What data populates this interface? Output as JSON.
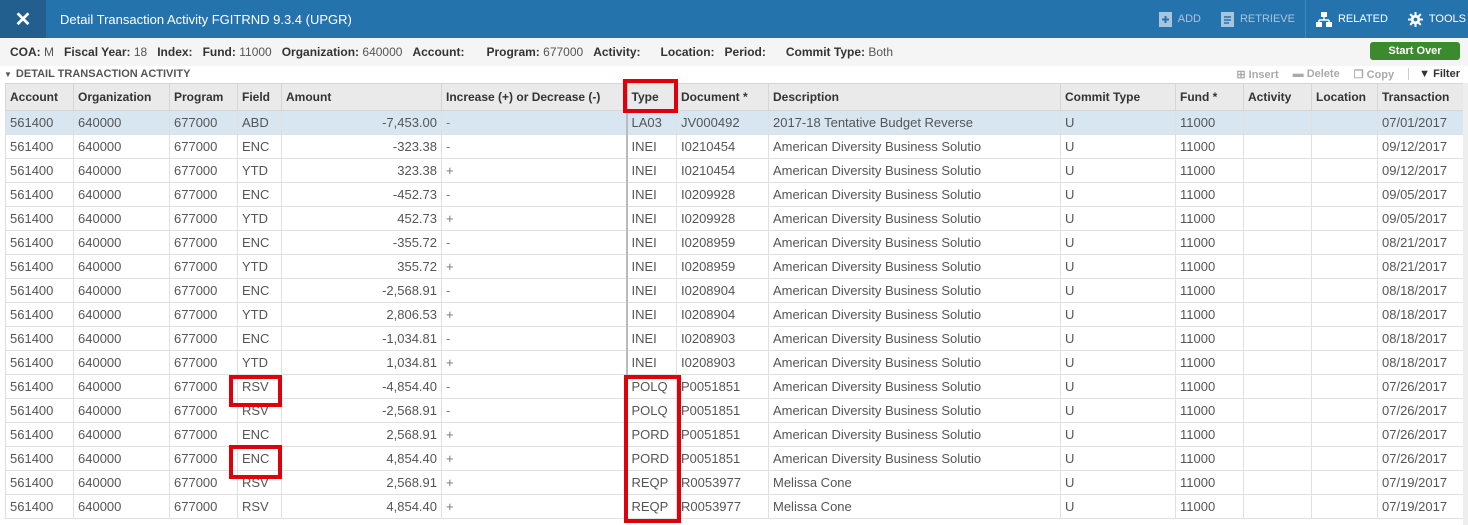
{
  "titlebar": {
    "title": "Detail Transaction Activity FGITRND 9.3.4 (UPGR)",
    "close_icon": "close-icon",
    "actions": {
      "add": "ADD",
      "retrieve": "RETRIEVE",
      "related": "RELATED",
      "tools": "TOOLS"
    }
  },
  "keyblock": {
    "coa_label": "COA:",
    "coa_value": "M",
    "fiscal_year_label": "Fiscal Year:",
    "fiscal_year_value": "18",
    "index_label": "Index:",
    "fund_label": "Fund:",
    "fund_value": "11000",
    "organization_label": "Organization:",
    "organization_value": "640000",
    "account_label": "Account:",
    "program_label": "Program:",
    "program_value": "677000",
    "activity_label": "Activity:",
    "location_label": "Location:",
    "period_label": "Period:",
    "commit_type_label": "Commit Type:",
    "commit_type_value": "Both",
    "start_over": "Start Over"
  },
  "section": {
    "title": "DETAIL TRANSACTION ACTIVITY",
    "insert": "Insert",
    "delete": "Delete",
    "copy": "Copy",
    "filter": "Filter"
  },
  "columns": [
    "Account",
    "Organization",
    "Program",
    "Field",
    "Amount",
    "Increase (+) or Decrease (-)",
    "Type",
    "Document *",
    "Description",
    "Commit Type",
    "Fund *",
    "Activity",
    "Location",
    "Transaction"
  ],
  "rows": [
    {
      "account": "561400",
      "org": "640000",
      "program": "677000",
      "field": "ABD",
      "amount": "-7,453.00",
      "sign": "-",
      "type": "LA03",
      "document": "JV000492",
      "description": "2017-18 Tentative Budget Reverse",
      "commit": "U",
      "fund": "11000",
      "activity": "",
      "location": "",
      "date": "07/01/2017"
    },
    {
      "account": "561400",
      "org": "640000",
      "program": "677000",
      "field": "ENC",
      "amount": "-323.38",
      "sign": "-",
      "type": "INEI",
      "document": "I0210454",
      "description": "American Diversity Business Solutio",
      "commit": "U",
      "fund": "11000",
      "activity": "",
      "location": "",
      "date": "09/12/2017"
    },
    {
      "account": "561400",
      "org": "640000",
      "program": "677000",
      "field": "YTD",
      "amount": "323.38",
      "sign": "+",
      "type": "INEI",
      "document": "I0210454",
      "description": "American Diversity Business Solutio",
      "commit": "U",
      "fund": "11000",
      "activity": "",
      "location": "",
      "date": "09/12/2017"
    },
    {
      "account": "561400",
      "org": "640000",
      "program": "677000",
      "field": "ENC",
      "amount": "-452.73",
      "sign": "-",
      "type": "INEI",
      "document": "I0209928",
      "description": "American Diversity Business Solutio",
      "commit": "U",
      "fund": "11000",
      "activity": "",
      "location": "",
      "date": "09/05/2017"
    },
    {
      "account": "561400",
      "org": "640000",
      "program": "677000",
      "field": "YTD",
      "amount": "452.73",
      "sign": "+",
      "type": "INEI",
      "document": "I0209928",
      "description": "American Diversity Business Solutio",
      "commit": "U",
      "fund": "11000",
      "activity": "",
      "location": "",
      "date": "09/05/2017"
    },
    {
      "account": "561400",
      "org": "640000",
      "program": "677000",
      "field": "ENC",
      "amount": "-355.72",
      "sign": "-",
      "type": "INEI",
      "document": "I0208959",
      "description": "American Diversity Business Solutio",
      "commit": "U",
      "fund": "11000",
      "activity": "",
      "location": "",
      "date": "08/21/2017"
    },
    {
      "account": "561400",
      "org": "640000",
      "program": "677000",
      "field": "YTD",
      "amount": "355.72",
      "sign": "+",
      "type": "INEI",
      "document": "I0208959",
      "description": "American Diversity Business Solutio",
      "commit": "U",
      "fund": "11000",
      "activity": "",
      "location": "",
      "date": "08/21/2017"
    },
    {
      "account": "561400",
      "org": "640000",
      "program": "677000",
      "field": "ENC",
      "amount": "-2,568.91",
      "sign": "-",
      "type": "INEI",
      "document": "I0208904",
      "description": "American Diversity Business Solutio",
      "commit": "U",
      "fund": "11000",
      "activity": "",
      "location": "",
      "date": "08/18/2017"
    },
    {
      "account": "561400",
      "org": "640000",
      "program": "677000",
      "field": "YTD",
      "amount": "2,806.53",
      "sign": "+",
      "type": "INEI",
      "document": "I0208904",
      "description": "American Diversity Business Solutio",
      "commit": "U",
      "fund": "11000",
      "activity": "",
      "location": "",
      "date": "08/18/2017"
    },
    {
      "account": "561400",
      "org": "640000",
      "program": "677000",
      "field": "ENC",
      "amount": "-1,034.81",
      "sign": "-",
      "type": "INEI",
      "document": "I0208903",
      "description": "American Diversity Business Solutio",
      "commit": "U",
      "fund": "11000",
      "activity": "",
      "location": "",
      "date": "08/18/2017"
    },
    {
      "account": "561400",
      "org": "640000",
      "program": "677000",
      "field": "YTD",
      "amount": "1,034.81",
      "sign": "+",
      "type": "INEI",
      "document": "I0208903",
      "description": "American Diversity Business Solutio",
      "commit": "U",
      "fund": "11000",
      "activity": "",
      "location": "",
      "date": "08/18/2017"
    },
    {
      "account": "561400",
      "org": "640000",
      "program": "677000",
      "field": "RSV",
      "amount": "-4,854.40",
      "sign": "-",
      "type": "POLQ",
      "document": "P0051851",
      "description": "American Diversity Business Solutio",
      "commit": "U",
      "fund": "11000",
      "activity": "",
      "location": "",
      "date": "07/26/2017"
    },
    {
      "account": "561400",
      "org": "640000",
      "program": "677000",
      "field": "RSV",
      "amount": "-2,568.91",
      "sign": "-",
      "type": "POLQ",
      "document": "P0051851",
      "description": "American Diversity Business Solutio",
      "commit": "U",
      "fund": "11000",
      "activity": "",
      "location": "",
      "date": "07/26/2017"
    },
    {
      "account": "561400",
      "org": "640000",
      "program": "677000",
      "field": "ENC",
      "amount": "2,568.91",
      "sign": "+",
      "type": "PORD",
      "document": "P0051851",
      "description": "American Diversity Business Solutio",
      "commit": "U",
      "fund": "11000",
      "activity": "",
      "location": "",
      "date": "07/26/2017"
    },
    {
      "account": "561400",
      "org": "640000",
      "program": "677000",
      "field": "ENC",
      "amount": "4,854.40",
      "sign": "+",
      "type": "PORD",
      "document": "P0051851",
      "description": "American Diversity Business Solutio",
      "commit": "U",
      "fund": "11000",
      "activity": "",
      "location": "",
      "date": "07/26/2017"
    },
    {
      "account": "561400",
      "org": "640000",
      "program": "677000",
      "field": "RSV",
      "amount": "2,568.91",
      "sign": "+",
      "type": "REQP",
      "document": "R0053977",
      "description": "Melissa Cone",
      "commit": "U",
      "fund": "11000",
      "activity": "",
      "location": "",
      "date": "07/19/2017"
    },
    {
      "account": "561400",
      "org": "640000",
      "program": "677000",
      "field": "RSV",
      "amount": "4,854.40",
      "sign": "+",
      "type": "REQP",
      "document": "R0053977",
      "description": "Melissa Cone",
      "commit": "U",
      "fund": "11000",
      "activity": "",
      "location": "",
      "date": "07/19/2017"
    }
  ],
  "colors": {
    "titlebar": "#2573ad",
    "highlight": "#e0000b",
    "start_over": "#3c8a2e",
    "selected_row": "#d8e6f1"
  }
}
